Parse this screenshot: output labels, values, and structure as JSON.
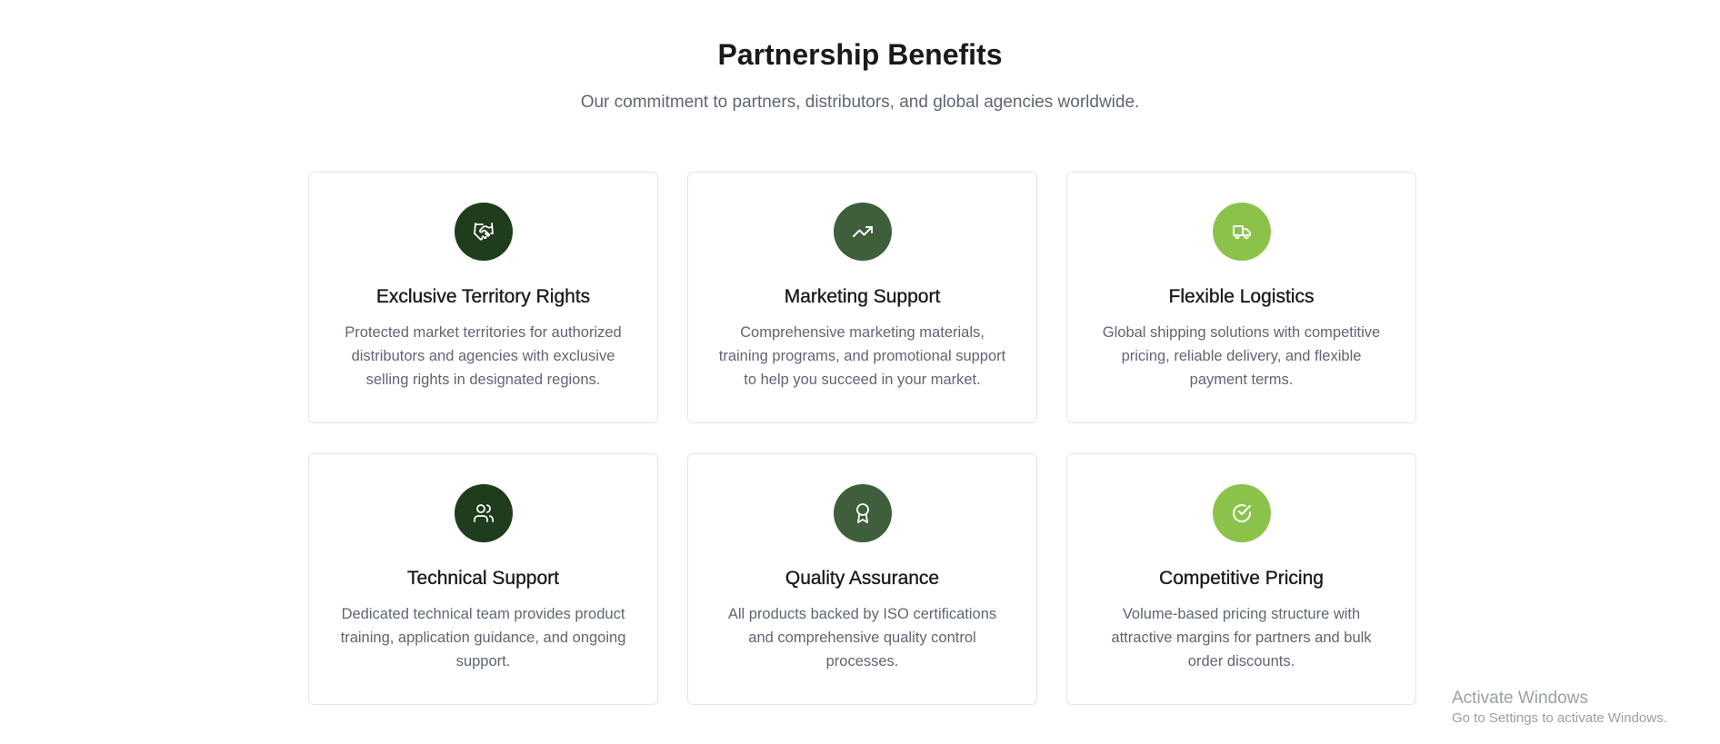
{
  "header": {
    "title": "Partnership Benefits",
    "subtitle": "Our commitment to partners, distributors, and global agencies worldwide."
  },
  "benefits": [
    {
      "icon": "handshake-icon",
      "color": "#1f3d1c",
      "title": "Exclusive Territory Rights",
      "description": "Protected market territories for authorized distributors and agencies with exclusive selling rights in designated regions."
    },
    {
      "icon": "trending-up-icon",
      "color": "#3f5f3c",
      "title": "Marketing Support",
      "description": "Comprehensive marketing materials, training programs, and promotional support to help you succeed in your market."
    },
    {
      "icon": "truck-icon",
      "color": "#8bc34a",
      "title": "Flexible Logistics",
      "description": "Global shipping solutions with competitive pricing, reliable delivery, and flexible payment terms."
    },
    {
      "icon": "users-icon",
      "color": "#1f3d1c",
      "title": "Technical Support",
      "description": "Dedicated technical team provides product training, application guidance, and ongoing support."
    },
    {
      "icon": "award-icon",
      "color": "#3f5f3c",
      "title": "Quality Assurance",
      "description": "All products backed by ISO certifications and comprehensive quality control processes."
    },
    {
      "icon": "check-circle-icon",
      "color": "#8bc34a",
      "title": "Competitive Pricing",
      "description": "Volume-based pricing structure with attractive margins for partners and bulk order discounts."
    }
  ],
  "watermark": {
    "title": "Activate Windows",
    "subtitle": "Go to Settings to activate Windows."
  }
}
